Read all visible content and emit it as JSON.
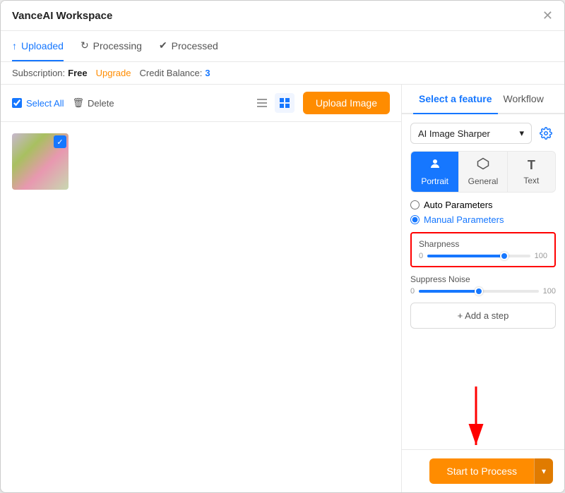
{
  "window": {
    "title": "VanceAI Workspace"
  },
  "tabs": [
    {
      "id": "uploaded",
      "label": "Uploaded",
      "icon": "↑",
      "active": true
    },
    {
      "id": "processing",
      "label": "Processing",
      "icon": "↻",
      "active": false
    },
    {
      "id": "processed",
      "label": "Processed",
      "icon": "✔",
      "active": false
    }
  ],
  "subscription": {
    "label": "Subscription:",
    "plan": "Free",
    "upgrade_label": "Upgrade",
    "credit_label": "Credit Balance:",
    "credit_count": "3"
  },
  "toolbar": {
    "select_all_label": "Select All",
    "delete_label": "Delete",
    "upload_label": "Upload Image"
  },
  "feature_panel": {
    "tabs": [
      {
        "id": "select-feature",
        "label": "Select a feature",
        "active": true
      },
      {
        "id": "workflow",
        "label": "Workflow",
        "active": false
      }
    ],
    "tool_name": "AI Image Sharper",
    "mode_tabs": [
      {
        "id": "portrait",
        "label": "Portrait",
        "icon": "👤",
        "active": true
      },
      {
        "id": "general",
        "label": "General",
        "icon": "⬡",
        "active": false
      },
      {
        "id": "text",
        "label": "Text",
        "icon": "T",
        "active": false
      }
    ],
    "auto_params_label": "Auto Parameters",
    "manual_params_label": "Manual Parameters",
    "sharpness": {
      "label": "Sharpness",
      "min": "0",
      "max": "100",
      "value": 75
    },
    "suppress_noise": {
      "label": "Suppress Noise",
      "min": "0",
      "max": "100",
      "value": 50
    },
    "add_step_label": "+ Add a step"
  },
  "bottom_bar": {
    "start_label": "Start to Process",
    "dropdown_icon": "▾"
  }
}
